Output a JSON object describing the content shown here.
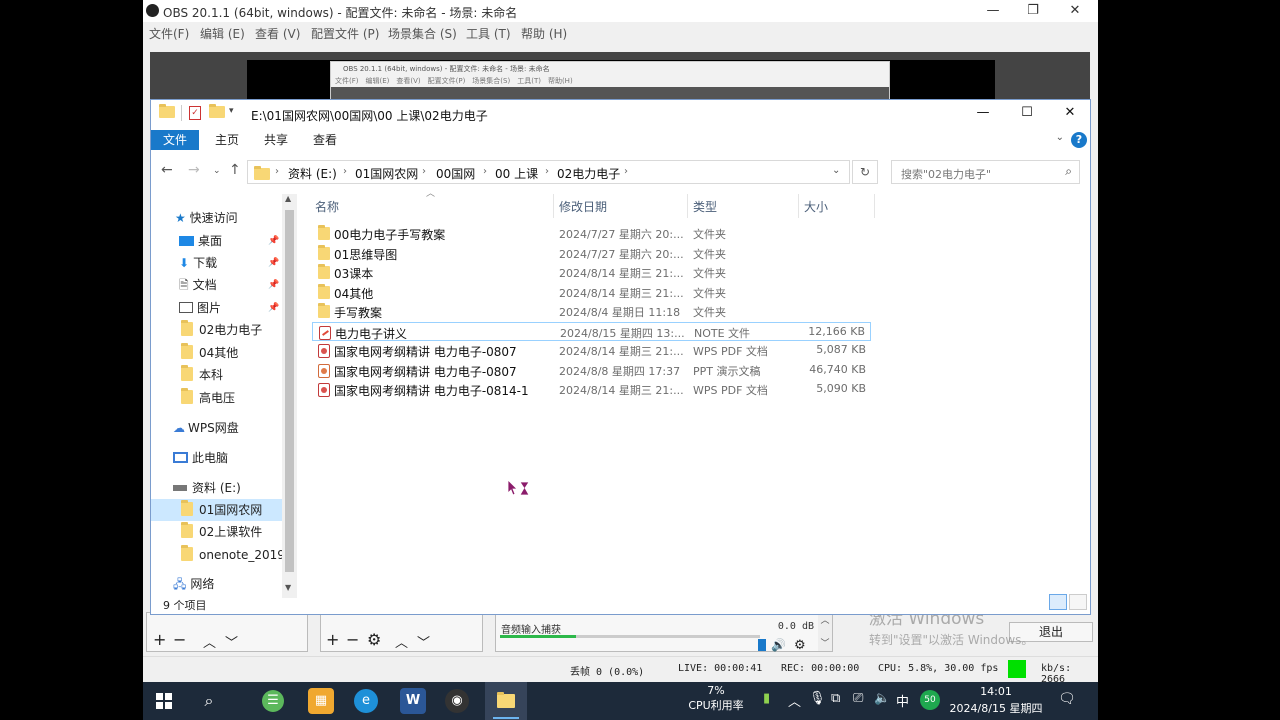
{
  "obs": {
    "title": "OBS 20.1.1 (64bit, windows) - 配置文件: 未命名 - 场景: 未命名",
    "menu": [
      "文件(F)",
      "编辑 (E)",
      "查看 (V)",
      "配置文件 (P)",
      "场景集合 (S)",
      "工具 (T)",
      "帮助 (H)"
    ],
    "nested_title": "OBS 20.1.1 (64bit, windows) - 配置文件: 未命名 - 场景: 未命名",
    "mixer_label": "音频输入捕获",
    "mixer_db": "0.0 dB",
    "exit_label": "退出",
    "status": {
      "dropped": "丢帧 0 (0.0%)",
      "live": "LIVE: 00:00:41",
      "rec": "REC: 00:00:00",
      "cpu": "CPU: 5.8%, 30.00 fps",
      "kbs": "kb/s: 2666"
    },
    "activate_line1": "激活 Windows",
    "activate_line2": "转到\"设置\"以激活 Windows。"
  },
  "explorer": {
    "title_path": "E:\\01国网农网\\00国网\\00 上课\\02电力电子",
    "ribbon_tabs": [
      "文件",
      "主页",
      "共享",
      "查看"
    ],
    "breadcrumb": [
      "资料 (E:)",
      "01国网农网",
      "00国网",
      "00 上课",
      "02电力电子"
    ],
    "search_placeholder": "搜索\"02电力电子\"",
    "nav": {
      "quick_access": "快速访问",
      "items": [
        "桌面",
        "下载",
        "文档",
        "图片",
        "02电力电子",
        "04其他",
        "本科",
        "高电压"
      ],
      "wps": "WPS网盘",
      "this_pc": "此电脑",
      "drive": "资料 (E:)",
      "drive_items": [
        "01国网农网",
        "02上课软件",
        "onenote_2019"
      ],
      "network": "网络"
    },
    "columns": {
      "name": "名称",
      "date": "修改日期",
      "type": "类型",
      "size": "大小"
    },
    "files": [
      {
        "name": "00电力电子手写教案",
        "date": "2024/7/27 星期六 20:...",
        "type": "文件夹",
        "size": "",
        "icon": "folder-icon"
      },
      {
        "name": "01思维导图",
        "date": "2024/7/27 星期六 20:...",
        "type": "文件夹",
        "size": "",
        "icon": "folder-icon"
      },
      {
        "name": "03课本",
        "date": "2024/8/14 星期三 21:...",
        "type": "文件夹",
        "size": "",
        "icon": "folder-icon"
      },
      {
        "name": "04其他",
        "date": "2024/8/14 星期三 21:...",
        "type": "文件夹",
        "size": "",
        "icon": "folder-icon"
      },
      {
        "name": "手写教案",
        "date": "2024/8/4 星期日 11:18",
        "type": "文件夹",
        "size": "",
        "icon": "folder-icon"
      },
      {
        "name": "电力电子讲义",
        "date": "2024/8/15 星期四 13:...",
        "type": "NOTE 文件",
        "size": "12,166 KB",
        "icon": "note-file-icon"
      },
      {
        "name": "国家电网考纲精讲 电力电子-0807",
        "date": "2024/8/14 星期三 21:...",
        "type": "WPS PDF 文档",
        "size": "5,087 KB",
        "icon": "pdf-file-icon"
      },
      {
        "name": "国家电网考纲精讲 电力电子-0807",
        "date": "2024/8/8 星期四 17:37",
        "type": "PPT 演示文稿",
        "size": "46,740 KB",
        "icon": "ppt-file-icon"
      },
      {
        "name": "国家电网考纲精讲 电力电子-0814-1",
        "date": "2024/8/14 星期三 21:...",
        "type": "WPS PDF 文档",
        "size": "5,090 KB",
        "icon": "pdf-file-icon"
      }
    ],
    "status_count": "9 个项目"
  },
  "taskbar": {
    "cpu_percent": "7%",
    "cpu_label": "CPU利用率",
    "ime": "中",
    "badge": "50",
    "time": "14:01",
    "date": "2024/8/15 星期四"
  },
  "colors": {
    "accent": "#1979ca",
    "selection": "#cce8ff",
    "folder": "#f8d775",
    "taskbar": "#1d2a3a"
  }
}
